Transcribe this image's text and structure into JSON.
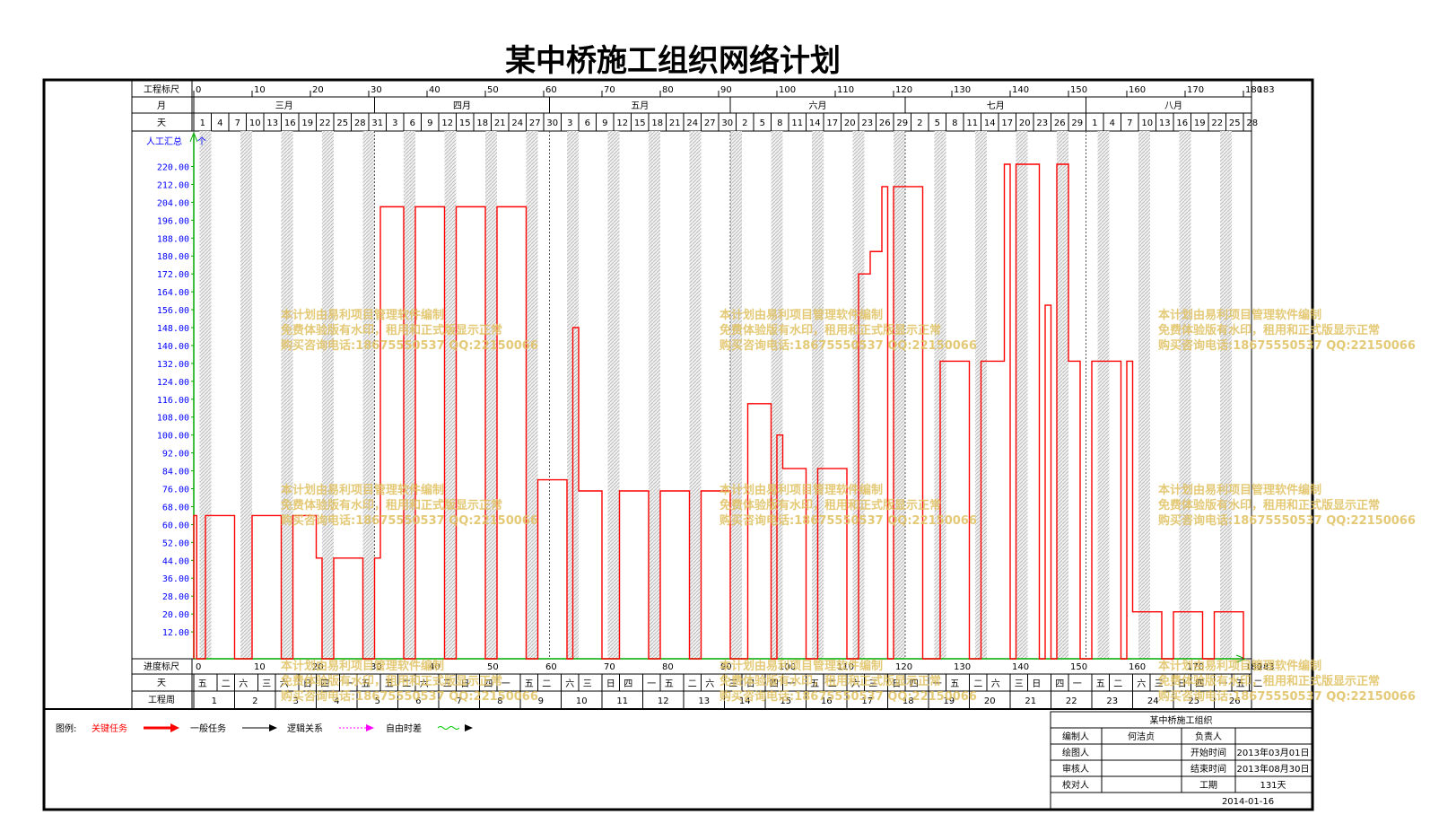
{
  "title": "某中桥施工组织网络计划",
  "row_labels": {
    "project_scale": "工程标尺",
    "month": "月",
    "day": "天",
    "progress_scale": "进度标尺",
    "weekday": "天",
    "project_week": "工程周"
  },
  "months": [
    "三月",
    "四月",
    "五月",
    "六月",
    "七月",
    "八月"
  ],
  "month_spans": [
    [
      0,
      31
    ],
    [
      31,
      61
    ],
    [
      61,
      92
    ],
    [
      92,
      122
    ],
    [
      122,
      153
    ],
    [
      153,
      183
    ]
  ],
  "scale_ticks": [
    0,
    10,
    20,
    30,
    40,
    50,
    60,
    70,
    80,
    90,
    100,
    110,
    120,
    130,
    140,
    150,
    160,
    170,
    180
  ],
  "scale_end_label": "183",
  "day_labels": [
    {
      "d": 0,
      "t": "1"
    },
    {
      "d": 3,
      "t": "4"
    },
    {
      "d": 6,
      "t": "7"
    },
    {
      "d": 9,
      "t": "10"
    },
    {
      "d": 12,
      "t": "13"
    },
    {
      "d": 15,
      "t": "16"
    },
    {
      "d": 18,
      "t": "19"
    },
    {
      "d": 21,
      "t": "22"
    },
    {
      "d": 24,
      "t": "25"
    },
    {
      "d": 27,
      "t": "28"
    },
    {
      "d": 30,
      "t": "31"
    },
    {
      "d": 33,
      "t": "3"
    },
    {
      "d": 36,
      "t": "6"
    },
    {
      "d": 39,
      "t": "9"
    },
    {
      "d": 42,
      "t": "12"
    },
    {
      "d": 45,
      "t": "15"
    },
    {
      "d": 48,
      "t": "18"
    },
    {
      "d": 51,
      "t": "21"
    },
    {
      "d": 54,
      "t": "24"
    },
    {
      "d": 57,
      "t": "27"
    },
    {
      "d": 60,
      "t": "30"
    },
    {
      "d": 63,
      "t": "3"
    },
    {
      "d": 66,
      "t": "6"
    },
    {
      "d": 69,
      "t": "9"
    },
    {
      "d": 72,
      "t": "12"
    },
    {
      "d": 75,
      "t": "15"
    },
    {
      "d": 78,
      "t": "18"
    },
    {
      "d": 81,
      "t": "21"
    },
    {
      "d": 84,
      "t": "24"
    },
    {
      "d": 87,
      "t": "27"
    },
    {
      "d": 90,
      "t": "30"
    },
    {
      "d": 93,
      "t": "2"
    },
    {
      "d": 96,
      "t": "5"
    },
    {
      "d": 99,
      "t": "8"
    },
    {
      "d": 102,
      "t": "11"
    },
    {
      "d": 105,
      "t": "14"
    },
    {
      "d": 108,
      "t": "17"
    },
    {
      "d": 111,
      "t": "20"
    },
    {
      "d": 114,
      "t": "23"
    },
    {
      "d": 117,
      "t": "26"
    },
    {
      "d": 120,
      "t": "29"
    },
    {
      "d": 123,
      "t": "2"
    },
    {
      "d": 126,
      "t": "5"
    },
    {
      "d": 129,
      "t": "8"
    },
    {
      "d": 132,
      "t": "11"
    },
    {
      "d": 135,
      "t": "14"
    },
    {
      "d": 138,
      "t": "17"
    },
    {
      "d": 141,
      "t": "20"
    },
    {
      "d": 144,
      "t": "23"
    },
    {
      "d": 147,
      "t": "26"
    },
    {
      "d": 150,
      "t": "29"
    },
    {
      "d": 153,
      "t": "1"
    },
    {
      "d": 156,
      "t": "4"
    },
    {
      "d": 159,
      "t": "7"
    },
    {
      "d": 162,
      "t": "10"
    },
    {
      "d": 165,
      "t": "13"
    },
    {
      "d": 168,
      "t": "16"
    },
    {
      "d": 171,
      "t": "19"
    },
    {
      "d": 174,
      "t": "22"
    },
    {
      "d": 177,
      "t": "25"
    },
    {
      "d": 180,
      "t": "28"
    }
  ],
  "weekday_labels": [
    {
      "d": 0,
      "t": "五"
    },
    {
      "d": 4,
      "t": "二"
    },
    {
      "d": 7,
      "t": "六"
    },
    {
      "d": 11,
      "t": "三"
    },
    {
      "d": 14,
      "t": "六"
    },
    {
      "d": 18,
      "t": "日"
    },
    {
      "d": 21,
      "t": "四"
    },
    {
      "d": 25,
      "t": "一"
    },
    {
      "d": 28,
      "t": "五"
    },
    {
      "d": 32,
      "t": "五"
    },
    {
      "d": 35,
      "t": "二"
    },
    {
      "d": 38,
      "t": "六"
    },
    {
      "d": 42,
      "t": "三"
    },
    {
      "d": 45,
      "t": "日"
    },
    {
      "d": 49,
      "t": "四"
    },
    {
      "d": 52,
      "t": "一"
    },
    {
      "d": 56,
      "t": "五"
    },
    {
      "d": 59,
      "t": "二"
    },
    {
      "d": 63,
      "t": "六"
    },
    {
      "d": 66,
      "t": "三"
    },
    {
      "d": 70,
      "t": "日"
    },
    {
      "d": 73,
      "t": "四"
    },
    {
      "d": 77,
      "t": "一"
    },
    {
      "d": 80,
      "t": "五"
    },
    {
      "d": 84,
      "t": "二"
    },
    {
      "d": 87,
      "t": "六"
    },
    {
      "d": 91,
      "t": "三"
    },
    {
      "d": 94,
      "t": "日"
    },
    {
      "d": 98,
      "t": "四"
    },
    {
      "d": 101,
      "t": "一"
    },
    {
      "d": 105,
      "t": "五"
    },
    {
      "d": 108,
      "t": "二"
    },
    {
      "d": 112,
      "t": "六"
    },
    {
      "d": 115,
      "t": "三"
    },
    {
      "d": 119,
      "t": "日"
    },
    {
      "d": 122,
      "t": "四"
    },
    {
      "d": 126,
      "t": "一"
    },
    {
      "d": 129,
      "t": "五"
    },
    {
      "d": 133,
      "t": "二"
    },
    {
      "d": 136,
      "t": "六"
    },
    {
      "d": 140,
      "t": "三"
    },
    {
      "d": 143,
      "t": "日"
    },
    {
      "d": 147,
      "t": "四"
    },
    {
      "d": 150,
      "t": "一"
    },
    {
      "d": 154,
      "t": "五"
    },
    {
      "d": 157,
      "t": "二"
    },
    {
      "d": 161,
      "t": "六"
    },
    {
      "d": 164,
      "t": "三"
    },
    {
      "d": 168,
      "t": "日"
    },
    {
      "d": 171,
      "t": "四"
    },
    {
      "d": 175,
      "t": "一"
    },
    {
      "d": 178,
      "t": "五"
    },
    {
      "d": 181,
      "t": "二"
    }
  ],
  "week_numbers": [
    "1",
    "2",
    "3",
    "4",
    "5",
    "6",
    "7",
    "8",
    "9",
    "10",
    "11",
    "12",
    "13",
    "14",
    "15",
    "16",
    "17",
    "18",
    "19",
    "20",
    "21",
    "22",
    "23",
    "24",
    "25",
    "26"
  ],
  "y_axis_label": "人工汇总",
  "y_axis_unit": "个",
  "watermark": [
    "本计划由易利项目管理软件编制",
    "免费体验版有水印，租用和正式版显示正常",
    "购买咨询电话:18675550537 QQ:22150066"
  ],
  "legend": {
    "prefix": "图例:",
    "critical": "关键任务",
    "general": "一般任务",
    "logic": "逻辑关系",
    "free_float": "自由时差"
  },
  "title_block": {
    "heading": "某中桥施工组织",
    "editor_label": "编制人",
    "editor": "何洁贞",
    "owner_label": "负责人",
    "drafter_label": "绘图人",
    "start_label": "开始时间",
    "start": "2013年03月01日",
    "reviewer_label": "审核人",
    "end_label": "结束时间",
    "end": "2013年08月30日",
    "checker_label": "校对人",
    "duration_label": "工期",
    "duration": "131天",
    "date": "2014-01-16"
  },
  "colors": {
    "resource_line": "#ff0000",
    "axis": "#00aa00",
    "tick_text": "#0000ff",
    "watermark": "#e0c060"
  },
  "chart_data": {
    "type": "line",
    "title": "某中桥施工组织网络计划",
    "xlabel": "工程标尺",
    "ylabel": "人工汇总",
    "xlim": [
      0,
      183
    ],
    "ylim": [
      0,
      228
    ],
    "y_ticks": [
      "12.00",
      "20.00",
      "28.00",
      "36.00",
      "44.00",
      "52.00",
      "60.00",
      "68.00",
      "76.00",
      "84.00",
      "92.00",
      "100.00",
      "108.00",
      "116.00",
      "124.00",
      "132.00",
      "140.00",
      "148.00",
      "156.00",
      "164.00",
      "172.00",
      "180.00",
      "188.00",
      "196.00",
      "204.00",
      "212.00",
      "220.00"
    ],
    "series": [
      {
        "name": "人工汇总",
        "step_points": [
          [
            0,
            64
          ],
          [
            0.5,
            0
          ],
          [
            2,
            64
          ],
          [
            7,
            0
          ],
          [
            10,
            64
          ],
          [
            15,
            0
          ],
          [
            17,
            64
          ],
          [
            21,
            45
          ],
          [
            22,
            0
          ],
          [
            24,
            45
          ],
          [
            29,
            0
          ],
          [
            31,
            45
          ],
          [
            32,
            202
          ],
          [
            36,
            0
          ],
          [
            38,
            202
          ],
          [
            43,
            0
          ],
          [
            45,
            202
          ],
          [
            50,
            0
          ],
          [
            52,
            202
          ],
          [
            57,
            0
          ],
          [
            59,
            80
          ],
          [
            64,
            0
          ],
          [
            65,
            148
          ],
          [
            66,
            75
          ],
          [
            70,
            0
          ],
          [
            73,
            75
          ],
          [
            78,
            0
          ],
          [
            80,
            75
          ],
          [
            85,
            0
          ],
          [
            87,
            75
          ],
          [
            92,
            0
          ],
          [
            95,
            114
          ],
          [
            99,
            0
          ],
          [
            100,
            100
          ],
          [
            101,
            85
          ],
          [
            105,
            0
          ],
          [
            107,
            85
          ],
          [
            112,
            0
          ],
          [
            114,
            172
          ],
          [
            116,
            182
          ],
          [
            118,
            211
          ],
          [
            119,
            0
          ],
          [
            120,
            211
          ],
          [
            125,
            0
          ],
          [
            128,
            133
          ],
          [
            133,
            0
          ],
          [
            135,
            133
          ],
          [
            139,
            221
          ],
          [
            140,
            0
          ],
          [
            141,
            221
          ],
          [
            145,
            0
          ],
          [
            146,
            158
          ],
          [
            147,
            0
          ],
          [
            148,
            221
          ],
          [
            150,
            133
          ],
          [
            152,
            0
          ],
          [
            154,
            133
          ],
          [
            159,
            0
          ],
          [
            160,
            133
          ],
          [
            161,
            21
          ],
          [
            166,
            0
          ],
          [
            168,
            21
          ],
          [
            173,
            0
          ],
          [
            175,
            21
          ],
          [
            180,
            0
          ]
        ]
      }
    ]
  }
}
